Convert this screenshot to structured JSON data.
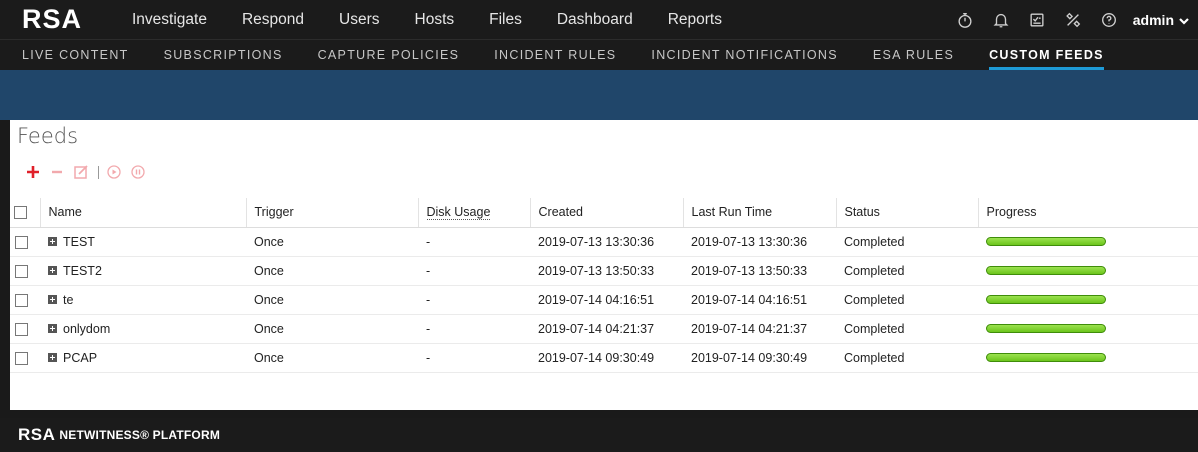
{
  "app": {
    "logo": "RSA",
    "user": "admin"
  },
  "topnav": {
    "items": [
      "Investigate",
      "Respond",
      "Users",
      "Hosts",
      "Files",
      "Dashboard",
      "Reports"
    ],
    "icons": [
      "stopwatch-icon",
      "bell-icon",
      "checklist-icon",
      "tools-icon",
      "help-icon"
    ]
  },
  "subnav": {
    "items": [
      "LIVE CONTENT",
      "SUBSCRIPTIONS",
      "CAPTURE POLICIES",
      "INCIDENT RULES",
      "INCIDENT NOTIFICATIONS",
      "ESA RULES",
      "CUSTOM FEEDS"
    ],
    "active": "CUSTOM FEEDS"
  },
  "panel": {
    "title": "Feeds"
  },
  "table": {
    "columns": [
      "Name",
      "Trigger",
      "Disk Usage",
      "Created",
      "Last Run Time",
      "Status",
      "Progress"
    ],
    "rows": [
      {
        "name": "TEST",
        "trigger": "Once",
        "disk": "-",
        "created": "2019-07-13 13:30:36",
        "last_run": "2019-07-13 13:30:36",
        "status": "Completed",
        "progress": 1.0
      },
      {
        "name": "TEST2",
        "trigger": "Once",
        "disk": "-",
        "created": "2019-07-13 13:50:33",
        "last_run": "2019-07-13 13:50:33",
        "status": "Completed",
        "progress": 1.0
      },
      {
        "name": "te",
        "trigger": "Once",
        "disk": "-",
        "created": "2019-07-14 04:16:51",
        "last_run": "2019-07-14 04:16:51",
        "status": "Completed",
        "progress": 1.0
      },
      {
        "name": "onlydom",
        "trigger": "Once",
        "disk": "-",
        "created": "2019-07-14 04:21:37",
        "last_run": "2019-07-14 04:21:37",
        "status": "Completed",
        "progress": 1.0
      },
      {
        "name": "PCAP",
        "trigger": "Once",
        "disk": "-",
        "created": "2019-07-14 09:30:49",
        "last_run": "2019-07-14 09:30:49",
        "status": "Completed",
        "progress": 1.0
      }
    ]
  },
  "footer": {
    "logo": "RSA",
    "text": "NETWITNESS® PLATFORM"
  },
  "colors": {
    "accent": "#1e9ad6",
    "add": "#e0202a",
    "progress": "#7ed321",
    "band": "#20466a"
  }
}
